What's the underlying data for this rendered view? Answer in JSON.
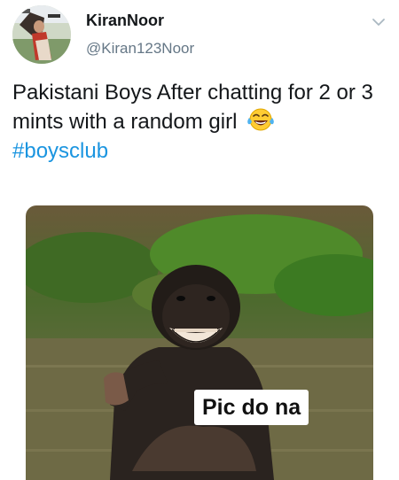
{
  "user": {
    "display_name": "KiranNoor",
    "handle": "@Kiran123Noor",
    "avatar_icon": "profile-photo"
  },
  "tweet": {
    "text": "Pakistani Boys After chatting for 2 or 3 mints with a random girl",
    "emoji": "😂",
    "emoji_icon": "laughing-tears-emoji",
    "hashtag": "#boysclub"
  },
  "media": {
    "caption": "Pic do na",
    "subject_icon": "laughing-chimp-photo"
  },
  "menu": {
    "icon": "chevron-down-icon"
  },
  "colors": {
    "link": "#1b95e0",
    "secondary_text": "#657786",
    "primary_text": "#14171a"
  }
}
